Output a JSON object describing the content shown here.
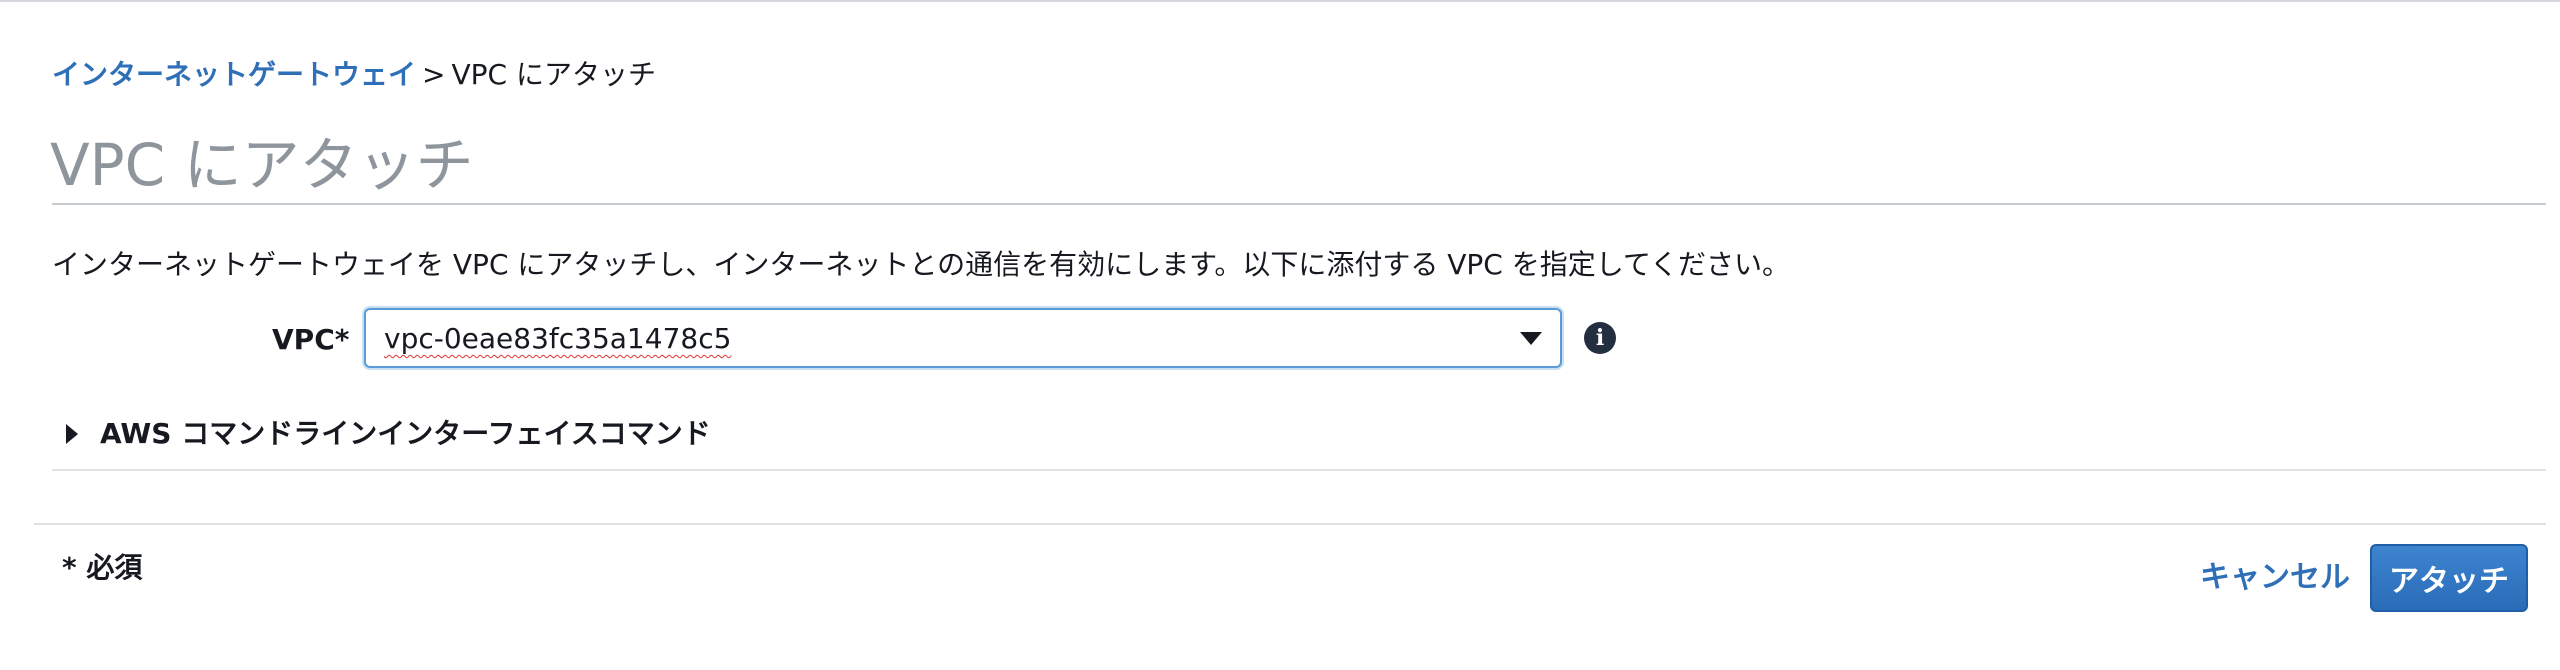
{
  "breadcrumb": {
    "parent": "インターネットゲートウェイ",
    "separator": ">",
    "current": "VPC にアタッチ"
  },
  "page": {
    "title": "VPC にアタッチ",
    "description": "インターネットゲートウェイを VPC にアタッチし、インターネットとの通信を有効にします。以下に添付する VPC を指定してください。"
  },
  "form": {
    "vpc_label": "VPC*",
    "vpc_value": "vpc-0eae83fc35a1478c5",
    "info_glyph": "i"
  },
  "cli_section": {
    "label": "AWS コマンドラインインターフェイスコマンド",
    "expanded": false
  },
  "footer": {
    "required_note": "* 必須",
    "cancel_label": "キャンセル",
    "attach_label": "アタッチ"
  },
  "colors": {
    "link": "#2e6fb7",
    "primary_button": "#2a6cb8",
    "title_gray": "#8f959c",
    "focus_border": "#5b9bd5"
  },
  "icons": {
    "select_caret": "caret-down-icon",
    "info": "info-icon",
    "expander": "caret-right-icon"
  }
}
